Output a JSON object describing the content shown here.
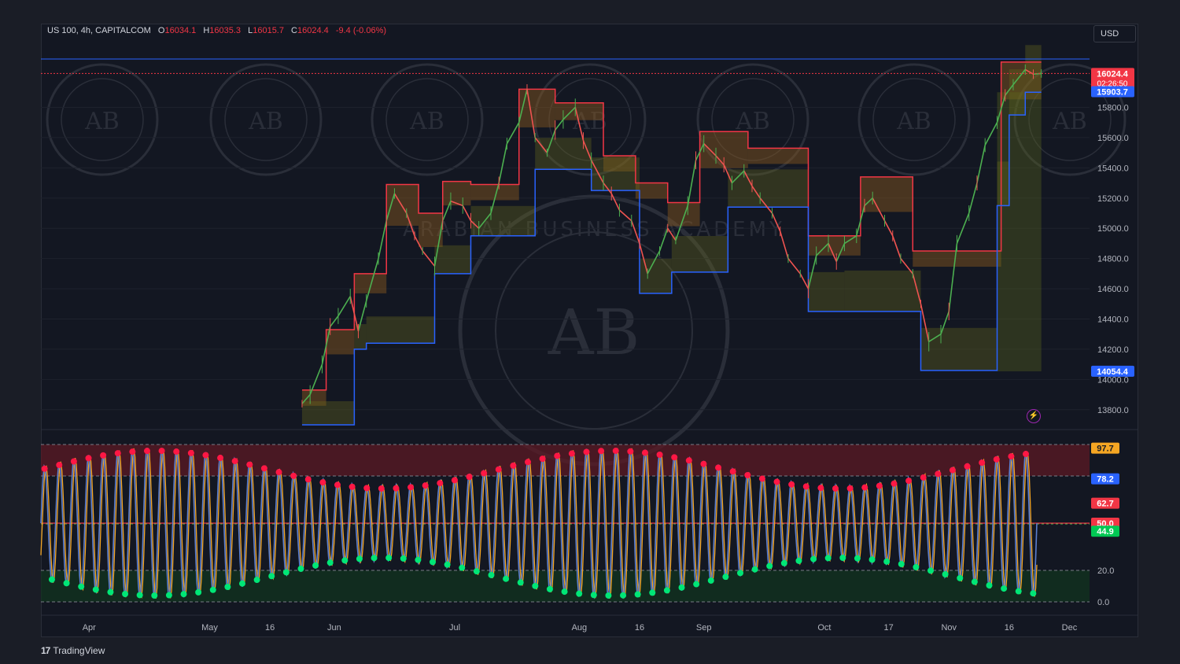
{
  "header": {
    "symbol": "US 100, 4h, CAPITALCOM",
    "open_label": "O",
    "open": "16034.1",
    "high_label": "H",
    "high": "16035.3",
    "low_label": "L",
    "low": "16015.7",
    "close_label": "C",
    "close": "16024.4",
    "change": "-9.4 (-0.06%)"
  },
  "currency": "USD",
  "brand": "TradingView",
  "watermark": {
    "text": "ARABIAN BUSINESS ACADEMY",
    "initials": "AB"
  },
  "colors": {
    "background": "#131722",
    "bull": "#26a69a",
    "bear": "#ef5350",
    "resistance": "#f23645",
    "support": "#2962ff",
    "stoch_k": "#5b7fd0",
    "stoch_d": "#f5a623",
    "overbought_zone": "#5c1a24",
    "oversold_zone": "#12341f",
    "price_label_red": "#f23645",
    "price_label_blue": "#2962ff",
    "stoch_orange": "#f5a623",
    "stoch_green": "#00c853"
  },
  "chart_data": [
    {
      "type": "line",
      "panel": "price",
      "title": "US 100, 4h, CAPITALCOM",
      "ylim": [
        13700,
        16250
      ],
      "y_ticks": [
        "13800.0",
        "14000.0",
        "14200.0",
        "14400.0",
        "14600.0",
        "14800.0",
        "15000.0",
        "15200.0",
        "15400.0",
        "15600.0",
        "15800.0"
      ],
      "x_ticks": [
        "Apr",
        "May",
        "16",
        "Jun",
        "Jul",
        "Aug",
        "16",
        "Sep",
        "Oct",
        "17",
        "Nov",
        "16",
        "Dec"
      ],
      "price_points": [
        [
          "2023-05-24",
          13840
        ],
        [
          "2023-05-26",
          13900
        ],
        [
          "2023-05-29",
          14100
        ],
        [
          "2023-05-31",
          14350
        ],
        [
          "2023-06-02",
          14420
        ],
        [
          "2023-06-05",
          14550
        ],
        [
          "2023-06-07",
          14320
        ],
        [
          "2023-06-09",
          14520
        ],
        [
          "2023-06-12",
          14800
        ],
        [
          "2023-06-14",
          15050
        ],
        [
          "2023-06-16",
          15230
        ],
        [
          "2023-06-19",
          15100
        ],
        [
          "2023-06-21",
          14950
        ],
        [
          "2023-06-23",
          14850
        ],
        [
          "2023-06-26",
          14750
        ],
        [
          "2023-06-28",
          15050
        ],
        [
          "2023-06-30",
          15180
        ],
        [
          "2023-07-03",
          15150
        ],
        [
          "2023-07-05",
          15050
        ],
        [
          "2023-07-07",
          15000
        ],
        [
          "2023-07-10",
          15100
        ],
        [
          "2023-07-12",
          15300
        ],
        [
          "2023-07-14",
          15560
        ],
        [
          "2023-07-17",
          15700
        ],
        [
          "2023-07-19",
          15920
        ],
        [
          "2023-07-21",
          15600
        ],
        [
          "2023-07-24",
          15500
        ],
        [
          "2023-07-26",
          15650
        ],
        [
          "2023-07-28",
          15720
        ],
        [
          "2023-07-31",
          15800
        ],
        [
          "2023-08-02",
          15580
        ],
        [
          "2023-08-04",
          15450
        ],
        [
          "2023-08-07",
          15300
        ],
        [
          "2023-08-09",
          15230
        ],
        [
          "2023-08-11",
          15120
        ],
        [
          "2023-08-14",
          15050
        ],
        [
          "2023-08-16",
          14900
        ],
        [
          "2023-08-18",
          14700
        ],
        [
          "2023-08-21",
          14850
        ],
        [
          "2023-08-23",
          15000
        ],
        [
          "2023-08-25",
          14920
        ],
        [
          "2023-08-28",
          15150
        ],
        [
          "2023-08-30",
          15450
        ],
        [
          "2023-09-01",
          15560
        ],
        [
          "2023-09-04",
          15480
        ],
        [
          "2023-09-06",
          15420
        ],
        [
          "2023-09-08",
          15300
        ],
        [
          "2023-09-11",
          15380
        ],
        [
          "2023-09-13",
          15280
        ],
        [
          "2023-09-15",
          15200
        ],
        [
          "2023-09-18",
          15100
        ],
        [
          "2023-09-20",
          14980
        ],
        [
          "2023-09-22",
          14800
        ],
        [
          "2023-09-25",
          14700
        ],
        [
          "2023-09-27",
          14600
        ],
        [
          "2023-09-29",
          14820
        ],
        [
          "2023-10-02",
          14900
        ],
        [
          "2023-10-04",
          14780
        ],
        [
          "2023-10-06",
          14900
        ],
        [
          "2023-10-09",
          14950
        ],
        [
          "2023-10-11",
          15150
        ],
        [
          "2023-10-13",
          15200
        ],
        [
          "2023-10-16",
          15050
        ],
        [
          "2023-10-18",
          14950
        ],
        [
          "2023-10-20",
          14800
        ],
        [
          "2023-10-23",
          14700
        ],
        [
          "2023-10-25",
          14500
        ],
        [
          "2023-10-27",
          14250
        ],
        [
          "2023-10-30",
          14300
        ],
        [
          "2023-11-01",
          14450
        ],
        [
          "2023-11-03",
          14900
        ],
        [
          "2023-11-06",
          15100
        ],
        [
          "2023-11-08",
          15300
        ],
        [
          "2023-11-10",
          15550
        ],
        [
          "2023-11-13",
          15700
        ],
        [
          "2023-11-15",
          15880
        ],
        [
          "2023-11-17",
          15950
        ],
        [
          "2023-11-20",
          16050
        ],
        [
          "2023-11-22",
          16020
        ],
        [
          "2023-11-24",
          16024
        ]
      ],
      "resistance_steps": [
        [
          "2023-05-24",
          13930
        ],
        [
          "2023-05-30",
          14330
        ],
        [
          "2023-06-06",
          14700
        ],
        [
          "2023-06-14",
          15290
        ],
        [
          "2023-06-22",
          15100
        ],
        [
          "2023-06-28",
          15310
        ],
        [
          "2023-07-05",
          15290
        ],
        [
          "2023-07-17",
          15920
        ],
        [
          "2023-07-26",
          15830
        ],
        [
          "2023-08-07",
          15480
        ],
        [
          "2023-08-15",
          15300
        ],
        [
          "2023-08-23",
          15170
        ],
        [
          "2023-08-31",
          15640
        ],
        [
          "2023-09-12",
          15530
        ],
        [
          "2023-09-27",
          14950
        ],
        [
          "2023-10-10",
          15340
        ],
        [
          "2023-10-23",
          14850
        ],
        [
          "2023-11-14",
          16100
        ],
        [
          "2023-11-24",
          16120
        ]
      ],
      "support_steps": [
        [
          "2023-05-24",
          13700
        ],
        [
          "2023-06-06",
          14200
        ],
        [
          "2023-06-09",
          14240
        ],
        [
          "2023-06-26",
          14700
        ],
        [
          "2023-07-05",
          14950
        ],
        [
          "2023-07-21",
          15390
        ],
        [
          "2023-08-04",
          15250
        ],
        [
          "2023-08-16",
          14570
        ],
        [
          "2023-08-24",
          14710
        ],
        [
          "2023-09-07",
          15140
        ],
        [
          "2023-09-27",
          14450
        ],
        [
          "2023-10-06",
          14450
        ],
        [
          "2023-10-25",
          14060
        ],
        [
          "2023-11-13",
          15150
        ],
        [
          "2023-11-16",
          15750
        ],
        [
          "2023-11-20",
          15900
        ],
        [
          "2023-11-24",
          15900
        ]
      ],
      "price_labels": [
        {
          "value": 16024.4,
          "text": "16024.4",
          "sub": "02:26:50",
          "color": "red"
        },
        {
          "value": 15903.7,
          "text": "15903.7",
          "color": "blue"
        },
        {
          "value": 14054.4,
          "text": "14054.4",
          "color": "blue"
        }
      ]
    },
    {
      "type": "line",
      "panel": "stochastic",
      "ylim": [
        0,
        100
      ],
      "levels": [
        0,
        20,
        50,
        80,
        100
      ],
      "y_ticks": [
        "0.0",
        "20.0"
      ],
      "value_labels": [
        {
          "value": 97.7,
          "text": "97.7",
          "color": "orange"
        },
        {
          "value": 78.2,
          "text": "78.2",
          "color": "blue"
        },
        {
          "value": 62.7,
          "text": "62.7",
          "color": "red"
        },
        {
          "value": 50.0,
          "text": "50.0",
          "color": "red"
        },
        {
          "value": 44.9,
          "text": "44.9",
          "color": "green"
        }
      ],
      "cycles": 68
    }
  ]
}
